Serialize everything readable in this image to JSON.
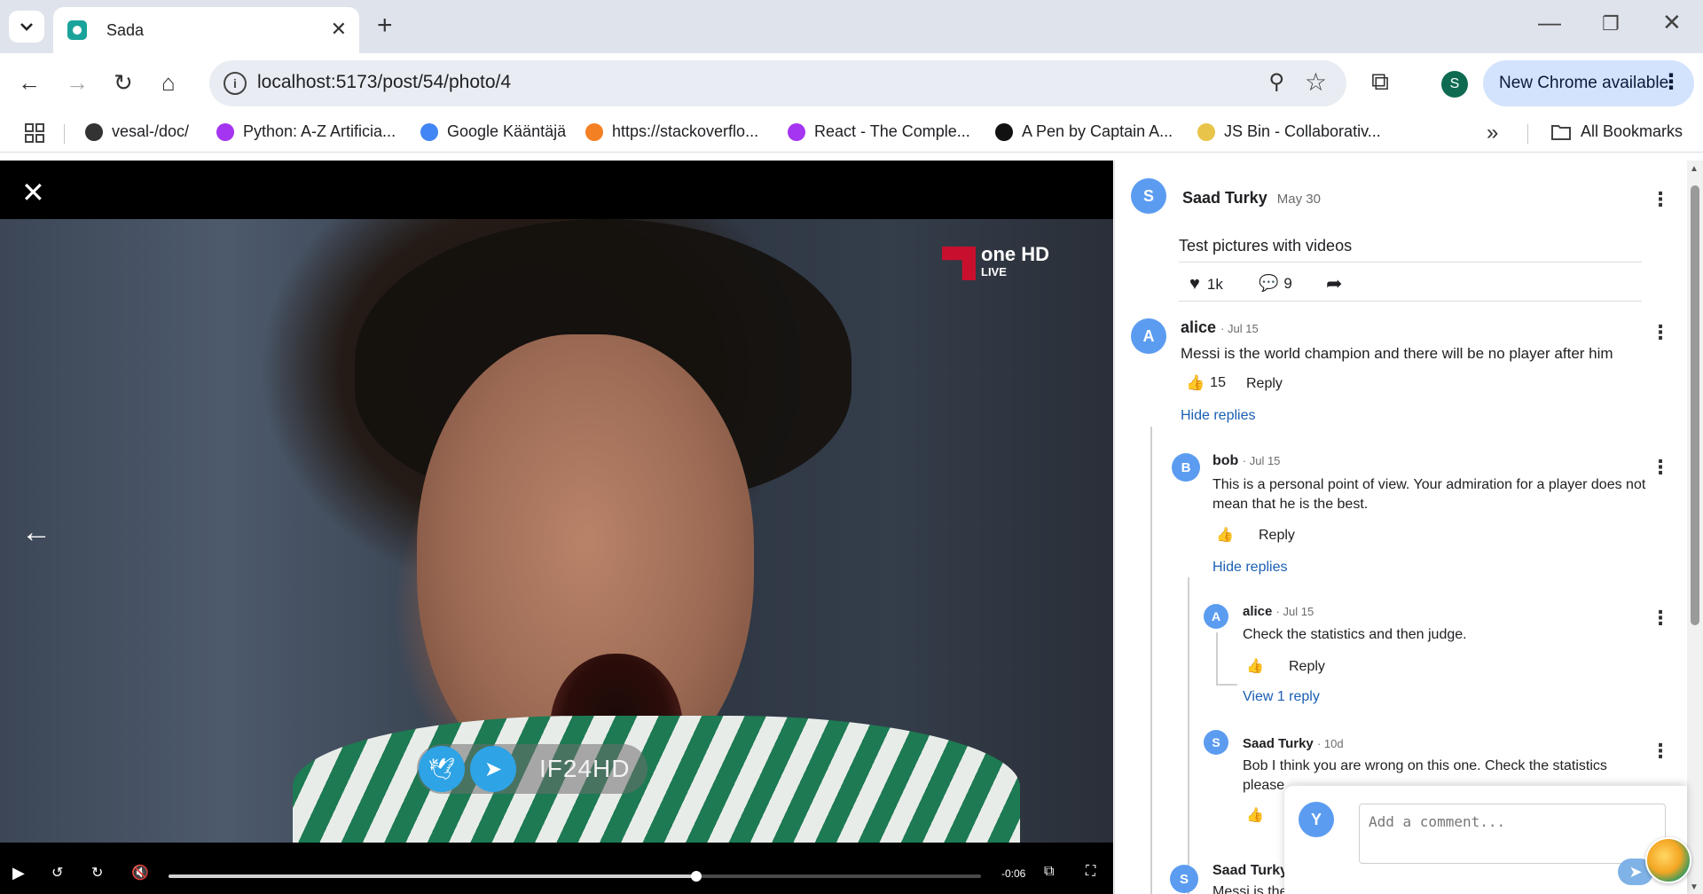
{
  "browser": {
    "tab_title": "Sada",
    "url": "localhost:5173/post/54/photo/4",
    "profile_initial": "S",
    "update_label": "New Chrome available",
    "bookmarks": [
      {
        "label": "vesal-/doc/",
        "icon": "github-icon",
        "color": "#333333"
      },
      {
        "label": "Python: A-Z Artificia...",
        "icon": "udemy-icon",
        "color": "#a435f0"
      },
      {
        "label": "Google Kääntäjä",
        "icon": "google-translate-icon",
        "color": "#4285f4"
      },
      {
        "label": "https://stackoverflo...",
        "icon": "stackoverflow-icon",
        "color": "#f48024"
      },
      {
        "label": "React - The Comple...",
        "icon": "udemy-icon",
        "color": "#a435f0"
      },
      {
        "label": "A Pen by Captain A...",
        "icon": "codepen-icon",
        "color": "#111111"
      },
      {
        "label": "JS Bin - Collaborativ...",
        "icon": "jsbin-icon",
        "color": "#e8c44a"
      }
    ],
    "all_bookmarks_label": "All Bookmarks"
  },
  "viewer": {
    "channel_logo_text": "one HD",
    "channel_live_text": "LIVE",
    "social_handle": "IF24HD",
    "time_remaining": "-0:06",
    "progress": 0.65
  },
  "post": {
    "author_initial": "S",
    "author": "Saad Turky",
    "date": "May 30",
    "text": "Test pictures with videos",
    "likes": "1k",
    "comments": "9"
  },
  "comments": [
    {
      "initial": "A",
      "author": "alice",
      "date": "· Jul 15",
      "text": "Messi is the world champion and there will be no player after him",
      "likes": "15",
      "reply_label": "Reply",
      "toggle": "Hide replies"
    },
    {
      "initial": "B",
      "author": "bob",
      "date": "· Jul 15",
      "text": "This is a personal point of view. Your admiration for a player does not mean that he is the best.",
      "reply_label": "Reply",
      "toggle": "Hide replies"
    },
    {
      "initial": "A",
      "author": "alice",
      "date": "· Jul 15",
      "text": "Check the statistics and then judge.",
      "reply_label": "Reply",
      "toggle": "View 1 reply"
    },
    {
      "initial": "S",
      "author": "Saad Turky",
      "date": "· 10d",
      "text": "Bob I think you are wrong on this one. Check the statistics please"
    },
    {
      "initial": "S",
      "author": "Saad Turky",
      "text": "Messi is the best and always will be"
    }
  ],
  "composer": {
    "avatar_initial": "Y",
    "placeholder": "Add a comment..."
  }
}
